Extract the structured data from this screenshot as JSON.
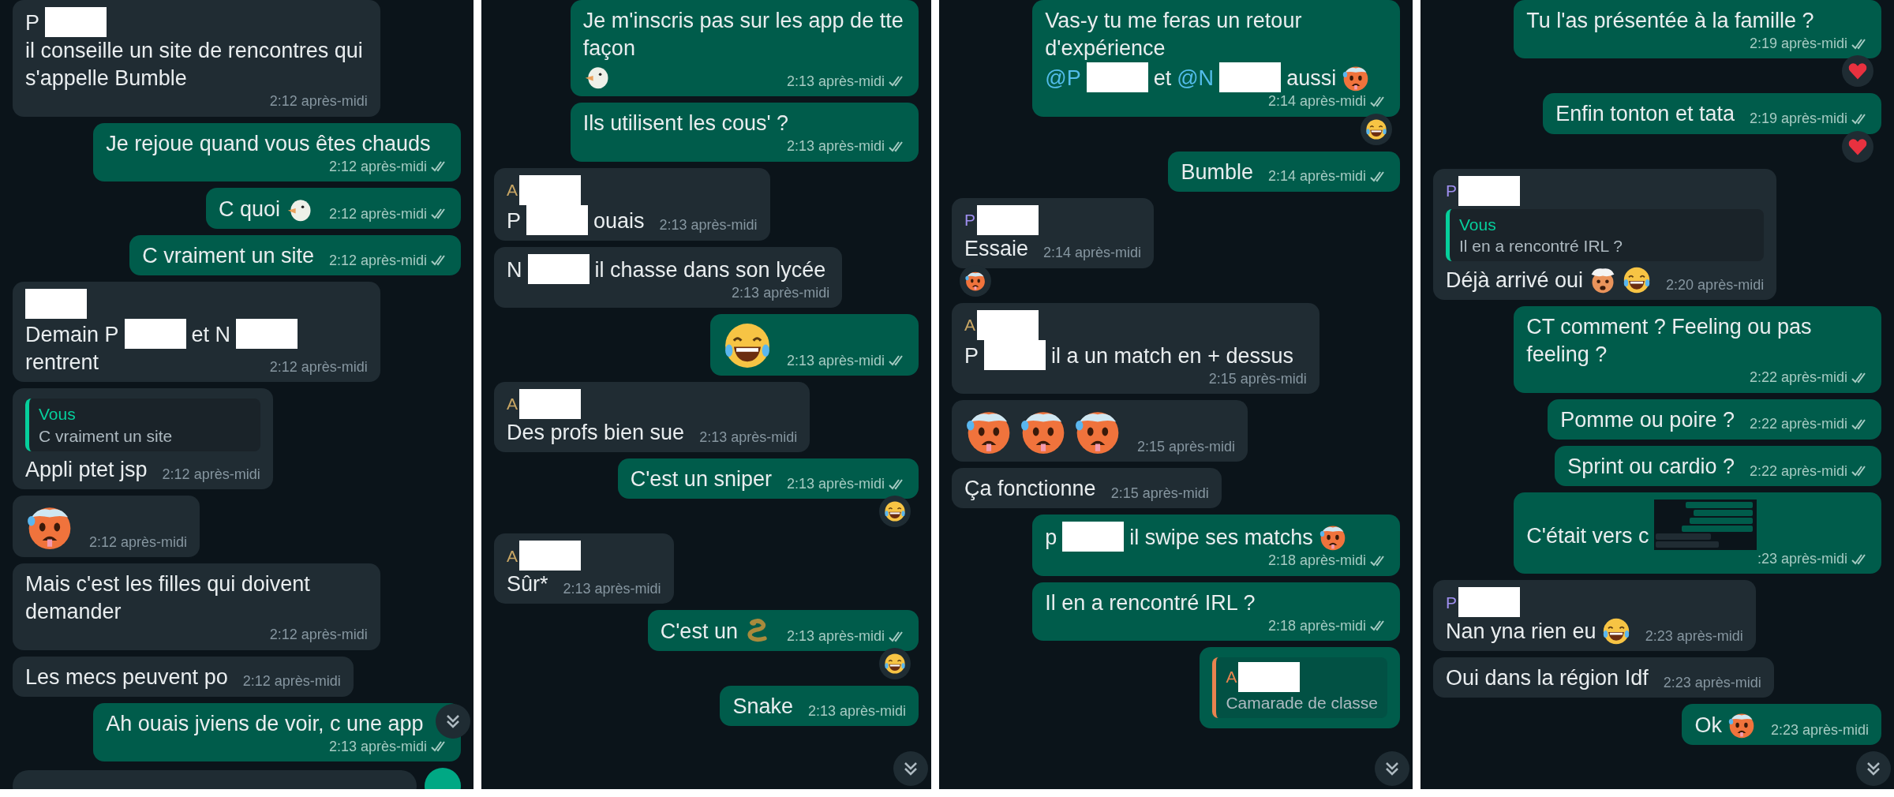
{
  "panels": [
    {
      "messages": [
        {
          "outgoing": false,
          "content": [
            {
              "kind": "text",
              "text": "P"
            },
            {
              "kind": "redact"
            },
            {
              "kind": "text",
              "text": "il conseille un site de rencontres qui s'appelle Bumble"
            }
          ],
          "time": "2:12 après-midi"
        },
        {
          "outgoing": true,
          "content": [
            {
              "kind": "text",
              "text": "Je rejoue quand vous êtes chauds"
            }
          ],
          "time": "2:12 après-midi",
          "delivered": true
        },
        {
          "outgoing": true,
          "content": [
            {
              "kind": "text",
              "text": "C quoi"
            },
            {
              "kind": "goose"
            }
          ],
          "time": "2:12 après-midi",
          "delivered": true
        },
        {
          "outgoing": true,
          "content": [
            {
              "kind": "text",
              "text": "C vraiment un site"
            }
          ],
          "time": "2:12 après-midi",
          "delivered": true
        },
        {
          "outgoing": false,
          "sender": {
            "parts": [
              {
                "kind": "redact"
              }
            ]
          },
          "content": [
            {
              "kind": "text",
              "text": "Demain P"
            },
            {
              "kind": "redact"
            },
            {
              "kind": "text",
              "text": "et N"
            },
            {
              "kind": "redact"
            },
            {
              "kind": "text",
              "text": "rentrent"
            }
          ],
          "time": "2:12 après-midi"
        },
        {
          "outgoing": false,
          "quote": {
            "color": "#06cf9c",
            "author": [
              {
                "kind": "text",
                "text": "Vous"
              }
            ],
            "text": "C vraiment un site"
          },
          "content": [
            {
              "kind": "text",
              "text": "Appli ptet jsp"
            }
          ],
          "time": "2:12 après-midi"
        },
        {
          "outgoing": false,
          "content": [
            {
              "kind": "hot"
            }
          ],
          "time": "2:12 après-midi"
        },
        {
          "outgoing": false,
          "content": [
            {
              "kind": "text",
              "text": "Mais c'est les filles qui doivent demander"
            }
          ],
          "time": "2:12 après-midi"
        },
        {
          "outgoing": false,
          "content": [
            {
              "kind": "text",
              "text": "Les mecs peuvent po"
            }
          ],
          "time": "2:12 après-midi"
        },
        {
          "outgoing": true,
          "content": [
            {
              "kind": "text",
              "text": "Ah ouais jviens de voir, c une app"
            }
          ],
          "time": "2:13 après-midi",
          "delivered": true
        }
      ],
      "composer": true
    },
    {
      "messages": [
        {
          "outgoing": true,
          "content": [
            {
              "kind": "text",
              "text": "Je m'inscris pas sur les app de tte façon"
            },
            {
              "kind": "goose"
            }
          ],
          "time": "2:13 après-midi",
          "delivered": true
        },
        {
          "outgoing": true,
          "content": [
            {
              "kind": "text",
              "text": "Ils utilisent les cous' ?"
            }
          ],
          "time": "2:13 après-midi",
          "delivered": true
        },
        {
          "outgoing": false,
          "sender": {
            "color": "#c8a664",
            "parts": [
              {
                "kind": "text",
                "text": "A"
              },
              {
                "kind": "redact"
              }
            ]
          },
          "content": [
            {
              "kind": "text",
              "text": "P"
            },
            {
              "kind": "redact"
            },
            {
              "kind": "text",
              "text": "ouais"
            }
          ],
          "time": "2:13 après-midi"
        },
        {
          "outgoing": false,
          "content": [
            {
              "kind": "text",
              "text": "N"
            },
            {
              "kind": "redact"
            },
            {
              "kind": "text",
              "text": "il chasse dans son lycée"
            }
          ],
          "time": "2:13 après-midi"
        },
        {
          "outgoing": true,
          "content": [
            {
              "kind": "laugh"
            }
          ],
          "time": "2:13 après-midi",
          "delivered": true
        },
        {
          "outgoing": false,
          "sender": {
            "color": "#c8a664",
            "parts": [
              {
                "kind": "text",
                "text": "A"
              },
              {
                "kind": "redact"
              }
            ]
          },
          "content": [
            {
              "kind": "text",
              "text": "Des profs bien sue"
            }
          ],
          "time": "2:13 après-midi"
        },
        {
          "outgoing": true,
          "content": [
            {
              "kind": "text",
              "text": "C'est un sniper"
            }
          ],
          "time": "2:13 après-midi",
          "delivered": true,
          "reaction": {
            "kind": "laugh"
          }
        },
        {
          "outgoing": false,
          "sender": {
            "color": "#c8a664",
            "parts": [
              {
                "kind": "text",
                "text": "A"
              },
              {
                "kind": "redact"
              }
            ]
          },
          "content": [
            {
              "kind": "text",
              "text": "Sûr*"
            }
          ],
          "time": "2:13 après-midi"
        },
        {
          "outgoing": true,
          "content": [
            {
              "kind": "text",
              "text": "C'est un"
            },
            {
              "kind": "snake"
            }
          ],
          "time": "2:13 après-midi",
          "delivered": true,
          "reaction": {
            "kind": "laugh"
          }
        },
        {
          "outgoing": true,
          "content": [
            {
              "kind": "text",
              "text": "Snake"
            }
          ],
          "time": "2:13 après-midi"
        }
      ]
    },
    {
      "messages": [
        {
          "outgoing": true,
          "content": [
            {
              "kind": "text",
              "text": "Vas-y tu me feras un retour d'expérience"
            },
            {
              "kind": "mention",
              "text": "@P"
            },
            {
              "kind": "redact"
            },
            {
              "kind": "text",
              "text": "et"
            },
            {
              "kind": "mention",
              "text": "@N"
            },
            {
              "kind": "redact"
            },
            {
              "kind": "text",
              "text": "aussi"
            },
            {
              "kind": "hot"
            }
          ],
          "time": "2:14 après-midi",
          "delivered": true,
          "reaction": {
            "kind": "laugh"
          }
        },
        {
          "outgoing": true,
          "content": [
            {
              "kind": "text",
              "text": "Bumble"
            }
          ],
          "time": "2:14 après-midi",
          "delivered": true
        },
        {
          "outgoing": false,
          "sender": {
            "color": "#9f8ff0",
            "parts": [
              {
                "kind": "text",
                "text": "P"
              },
              {
                "kind": "redact"
              }
            ]
          },
          "content": [
            {
              "kind": "text",
              "text": "Essaie"
            }
          ],
          "time": "2:14 après-midi",
          "reaction": {
            "kind": "hot"
          }
        },
        {
          "outgoing": false,
          "sender": {
            "color": "#c8a664",
            "parts": [
              {
                "kind": "text",
                "text": "A"
              },
              {
                "kind": "redact"
              }
            ]
          },
          "content": [
            {
              "kind": "text",
              "text": "P"
            },
            {
              "kind": "redact"
            },
            {
              "kind": "text",
              "text": "il a un match en + dessus"
            }
          ],
          "time": "2:15 après-midi"
        },
        {
          "outgoing": false,
          "content": [
            {
              "kind": "hot"
            },
            {
              "kind": "hot"
            },
            {
              "kind": "hot"
            }
          ],
          "time": "2:15 après-midi"
        },
        {
          "outgoing": false,
          "content": [
            {
              "kind": "text",
              "text": "Ça fonctionne"
            }
          ],
          "time": "2:15 après-midi"
        },
        {
          "outgoing": true,
          "content": [
            {
              "kind": "text",
              "text": "p"
            },
            {
              "kind": "redact"
            },
            {
              "kind": "text",
              "text": "il swipe ses matchs"
            },
            {
              "kind": "hot"
            }
          ],
          "time": "2:18 après-midi",
          "delivered": true
        },
        {
          "outgoing": true,
          "content": [
            {
              "kind": "text",
              "text": "Il en a rencontré IRL ?"
            }
          ],
          "time": "2:18 après-midi",
          "delivered": true
        },
        {
          "outgoing": true,
          "quote": {
            "color": "#e8834f",
            "author": [
              {
                "kind": "text",
                "text": "A"
              },
              {
                "kind": "redact"
              }
            ],
            "text": "Camarade de classe"
          }
        }
      ]
    },
    {
      "messages": [
        {
          "outgoing": true,
          "content": [
            {
              "kind": "text",
              "text": "Tu l'as présentée à la famille ?"
            }
          ],
          "time": "2:19 après-midi",
          "delivered": true,
          "reaction": {
            "kind": "heart"
          }
        },
        {
          "outgoing": true,
          "content": [
            {
              "kind": "text",
              "text": "Enfin tonton et tata"
            }
          ],
          "time": "2:19 après-midi",
          "delivered": true,
          "reaction": {
            "kind": "heart"
          }
        },
        {
          "outgoing": false,
          "sender": {
            "color": "#9f8ff0",
            "parts": [
              {
                "kind": "text",
                "text": "P"
              },
              {
                "kind": "redact"
              }
            ]
          },
          "quote": {
            "color": "#06cf9c",
            "author": [
              {
                "kind": "text",
                "text": "Vous"
              }
            ],
            "text": "Il en a rencontré IRL ?"
          },
          "content": [
            {
              "kind": "text",
              "text": "Déjà arrivé oui"
            },
            {
              "kind": "mindblown"
            },
            {
              "kind": "laugh"
            }
          ],
          "time": "2:20 après-midi"
        },
        {
          "outgoing": true,
          "content": [
            {
              "kind": "text",
              "text": "CT comment ? Feeling ou pas feeling ?"
            }
          ],
          "time": "2:22 après-midi",
          "delivered": true
        },
        {
          "outgoing": true,
          "content": [
            {
              "kind": "text",
              "text": "Pomme ou poire ?"
            }
          ],
          "time": "2:22 après-midi",
          "delivered": true
        },
        {
          "outgoing": true,
          "content": [
            {
              "kind": "text",
              "text": "Sprint ou cardio ?"
            }
          ],
          "time": "2:22 après-midi",
          "delivered": true
        },
        {
          "outgoing": true,
          "content": [
            {
              "kind": "text",
              "text": "C'était vers c"
            },
            {
              "kind": "thumbnail"
            }
          ],
          "time": ":23 après-midi",
          "delivered": true
        },
        {
          "outgoing": false,
          "sender": {
            "color": "#9f8ff0",
            "parts": [
              {
                "kind": "text",
                "text": "P"
              },
              {
                "kind": "redact"
              }
            ]
          },
          "content": [
            {
              "kind": "text",
              "text": "Nan yna rien eu"
            },
            {
              "kind": "laugh"
            }
          ],
          "time": "2:23 après-midi"
        },
        {
          "outgoing": false,
          "content": [
            {
              "kind": "text",
              "text": "Oui dans la région Idf"
            }
          ],
          "time": "2:23 après-midi"
        },
        {
          "outgoing": true,
          "content": [
            {
              "kind": "text",
              "text": "Ok"
            },
            {
              "kind": "hot"
            }
          ],
          "time": "2:23 après-midi"
        }
      ]
    }
  ]
}
